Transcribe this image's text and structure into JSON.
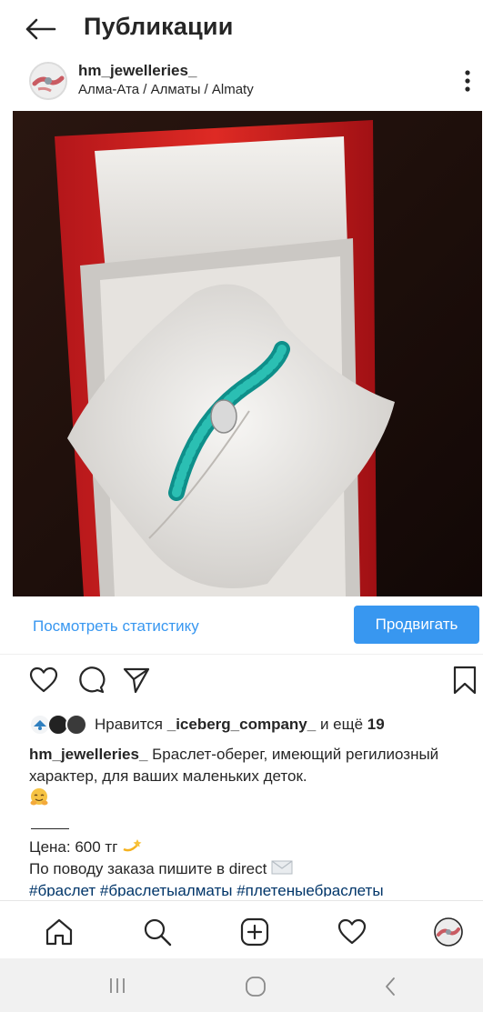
{
  "header": {
    "title": "Публикации",
    "back_icon": "arrow-left-icon"
  },
  "post": {
    "username": "hm_jewelleries_",
    "location": "Алма-Ата / Алматы / Almaty",
    "more_icon": "more-vertical-icon"
  },
  "stats": {
    "link": "Посмотреть статистику",
    "promote": "Продвигать",
    "accent": "#3897f0"
  },
  "likes": {
    "prefix": "Нравится ",
    "user": "_iceberg_company_",
    "middle": " и ещё ",
    "count": "19"
  },
  "caption": {
    "user": "hm_jewelleries_",
    "text": " Браслет-оберег, имеющий регилиозный характер, для ваших маленьких деток.",
    "price": "Цена: 600 тг",
    "order": "По поводу заказа пишите в direct",
    "tags": "#браслет #браслетыалматы #плетеныебраслеты"
  },
  "bottom_nav": [
    "home-icon",
    "search-icon",
    "add-post-icon",
    "heart-icon",
    "profile-avatar"
  ],
  "system_nav": [
    "recent-apps-icon",
    "home-circle-icon",
    "back-chevron-icon"
  ]
}
